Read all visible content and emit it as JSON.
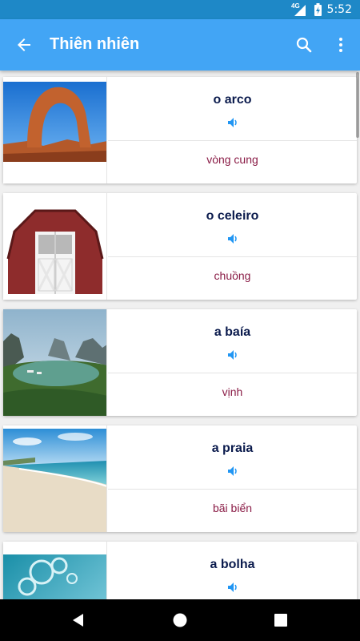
{
  "status_bar": {
    "network": "4G",
    "time": "5:52"
  },
  "app_bar": {
    "title": "Thiên nhiên",
    "back_icon": "arrow-back-icon",
    "search_icon": "search-icon",
    "more_icon": "more-vert-icon"
  },
  "colors": {
    "status_bar": "#1e88c7",
    "app_bar": "#42a5f5",
    "word": "#0b1b4d",
    "meaning": "#8a1c46",
    "speaker": "#2196f3"
  },
  "cards": [
    {
      "word": "o arco",
      "meaning": "vòng cung",
      "image": "arch-photo"
    },
    {
      "word": "o celeiro",
      "meaning": "chuồng",
      "image": "barn-photo"
    },
    {
      "word": "a baía",
      "meaning": "vịnh",
      "image": "bay-photo"
    },
    {
      "word": "a praia",
      "meaning": "bãi biển",
      "image": "beach-photo"
    },
    {
      "word": "a bolha",
      "meaning": "",
      "image": "bubble-photo"
    }
  ]
}
